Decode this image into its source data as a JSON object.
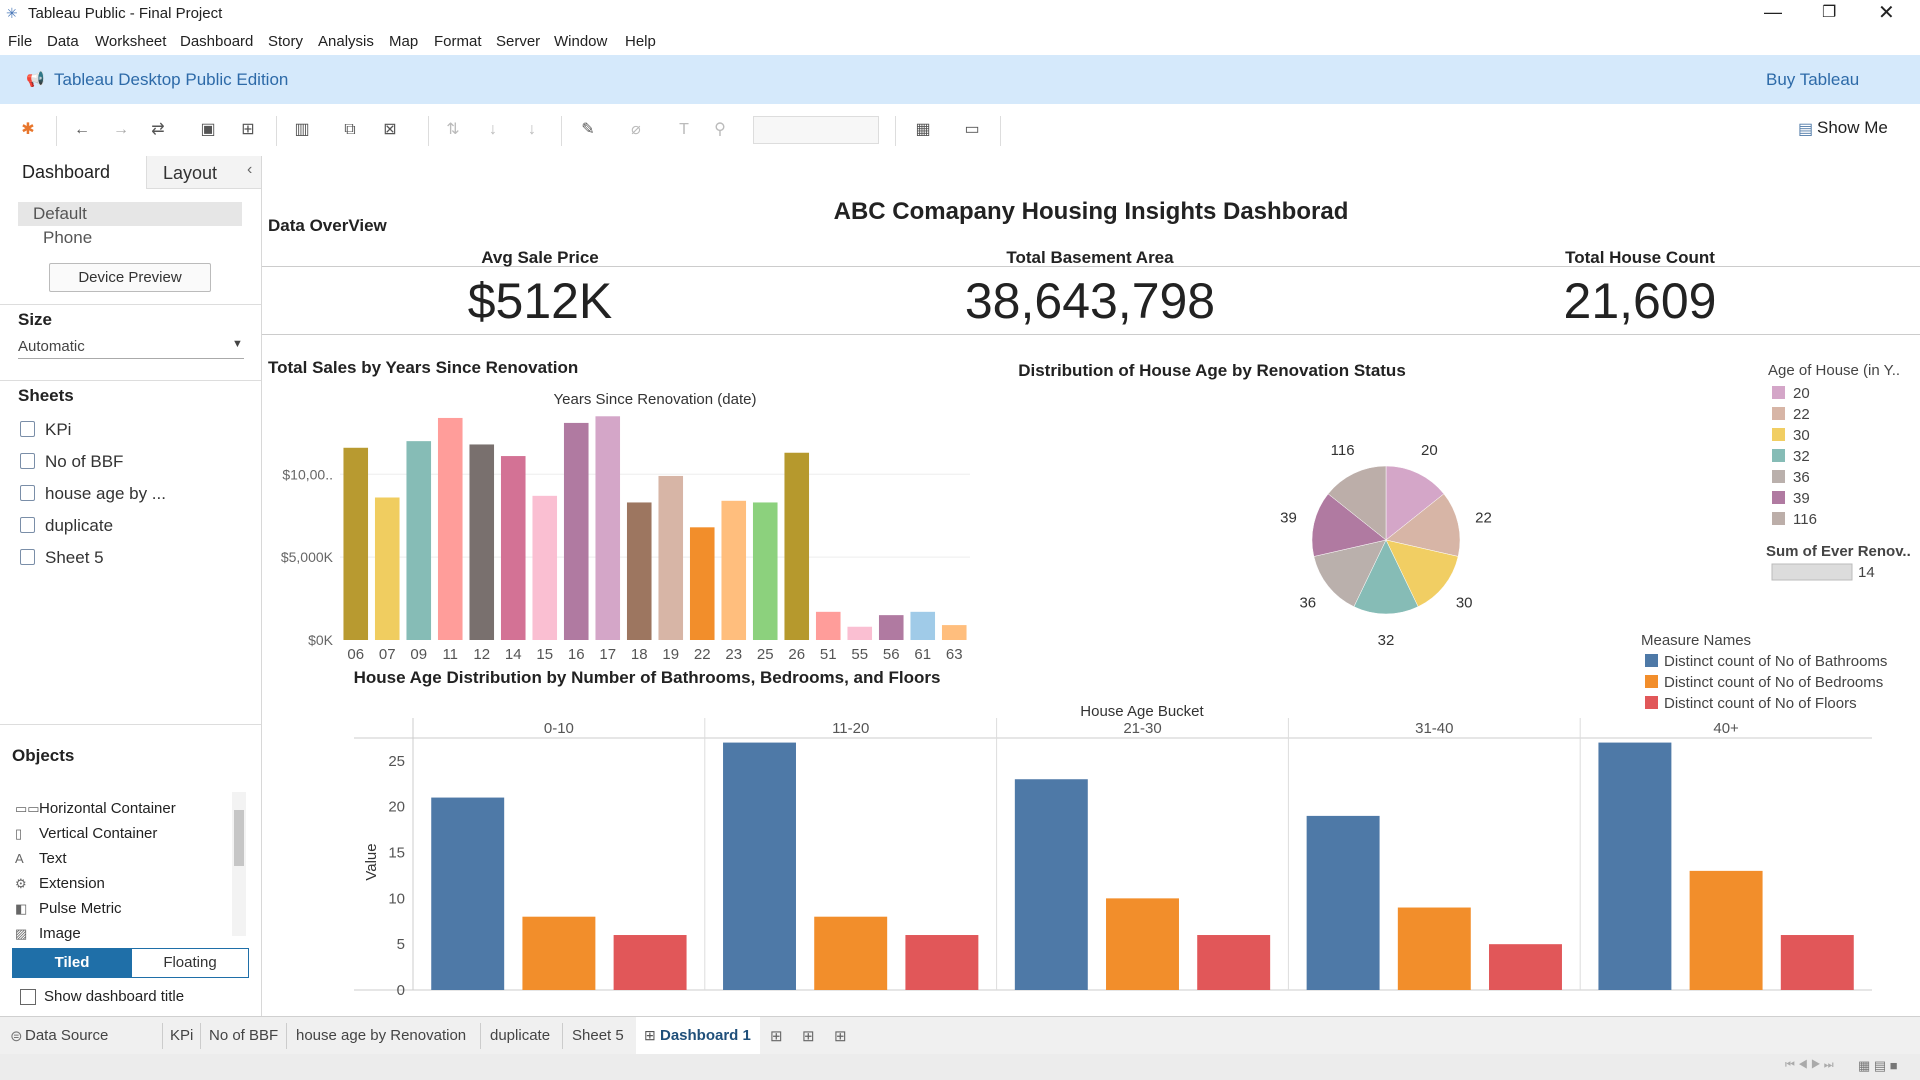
{
  "window": {
    "title": "Tableau Public - Final Project"
  },
  "menu": [
    "File",
    "Data",
    "Worksheet",
    "Dashboard",
    "Story",
    "Analysis",
    "Map",
    "Format",
    "Server",
    "Window",
    "Help"
  ],
  "banner": {
    "edition": "Tableau Desktop Public Edition",
    "buy": "Buy Tableau"
  },
  "toolbar": {
    "show_me": "Show Me"
  },
  "left": {
    "tabs": [
      "Dashboard",
      "Layout"
    ],
    "device_default": "Default",
    "device_phone": "Phone",
    "device_preview": "Device Preview",
    "size_title": "Size",
    "size_value": "Automatic",
    "sheets_title": "Sheets",
    "sheets": [
      "KPi",
      "No of BBF",
      "house age by ...",
      "duplicate",
      "Sheet 5"
    ],
    "objects_title": "Objects",
    "objects": [
      "Horizontal Container",
      "Vertical Container",
      "Text",
      "Extension",
      "Pulse Metric",
      "Image"
    ],
    "tiled": "Tiled",
    "floating": "Floating",
    "show_title": "Show dashboard title"
  },
  "bottom_tabs": [
    "Data Source",
    "KPi",
    "No of BBF",
    "house age by Renovation",
    "duplicate",
    "Sheet 5",
    "Dashboard 1"
  ],
  "dashboard": {
    "title": "ABC Comapany Housing Insights Dashborad",
    "overview": "Data OverView",
    "kpis": [
      {
        "label": "Avg Sale Price",
        "value": "$512K"
      },
      {
        "label": "Total Basement Area",
        "value": "38,643,798"
      },
      {
        "label": "Total House Count",
        "value": "21,609"
      }
    ]
  },
  "chart_data": [
    {
      "type": "bar",
      "title": "Total Sales by Years Since Renovation",
      "xlabel": "Years Since Renovation (date)",
      "categories": [
        "06",
        "07",
        "09",
        "11",
        "12",
        "14",
        "15",
        "16",
        "17",
        "18",
        "19",
        "22",
        "23",
        "25",
        "26",
        "51",
        "55",
        "56",
        "61",
        "63"
      ],
      "values": [
        11600,
        8600,
        12000,
        13400,
        11800,
        11100,
        8700,
        13100,
        13500,
        8300,
        9900,
        6800,
        8400,
        8300,
        11300,
        1700,
        800,
        1500,
        1700,
        900
      ],
      "colors": [
        "#b89a30",
        "#f0cd60",
        "#86bcb6",
        "#ff9d9a",
        "#79706e",
        "#d37295",
        "#fabfd2",
        "#b07aa1",
        "#d4a6c8",
        "#9d7660",
        "#d7b5a6",
        "#f28e2b",
        "#ffbe7d",
        "#8cd17d",
        "#b6992d",
        "#ff9d9a",
        "#fabfd2",
        "#b07aa1",
        "#a0cbe8",
        "#ffbe7d"
      ],
      "yticks": [
        "$0K",
        "$5,000K",
        "$10,00.."
      ],
      "ylim": [
        0,
        14000
      ]
    },
    {
      "type": "pie",
      "title": "Distribution of House Age by Renovation Status",
      "legend_title": "Age of House (in Y..",
      "labels": [
        "20",
        "22",
        "30",
        "32",
        "36",
        "39",
        "116"
      ],
      "values": [
        1,
        1,
        1,
        1,
        1,
        1,
        1
      ],
      "colors": [
        "#d4a6c8",
        "#d7b5a6",
        "#f1ce63",
        "#86bcb6",
        "#bab0ac",
        "#b07aa1",
        "#bcaea9"
      ],
      "size_legend_title": "Sum of Ever Renov..",
      "size_legend_value": "14"
    },
    {
      "type": "bar",
      "title": "House Age Distribution by Number of Bathrooms, Bedrooms, and Floors",
      "column_header": "House Age Bucket",
      "ylabel": "Value",
      "categories": [
        "0-10",
        "11-20",
        "21-30",
        "31-40",
        "40+"
      ],
      "legend_title": "Measure Names",
      "series": [
        {
          "name": "Distinct count of No of Bathrooms",
          "color": "#4e79a7",
          "values": [
            21,
            27,
            23,
            19,
            27
          ]
        },
        {
          "name": "Distinct count of No of Bedrooms",
          "color": "#f28e2b",
          "values": [
            8,
            8,
            10,
            9,
            13
          ]
        },
        {
          "name": "Distinct count of No of Floors",
          "color": "#e15759",
          "values": [
            6,
            6,
            6,
            5,
            6
          ]
        }
      ],
      "yticks": [
        "0",
        "5",
        "10",
        "15",
        "20",
        "25"
      ],
      "ylim": [
        0,
        27.5
      ]
    }
  ]
}
